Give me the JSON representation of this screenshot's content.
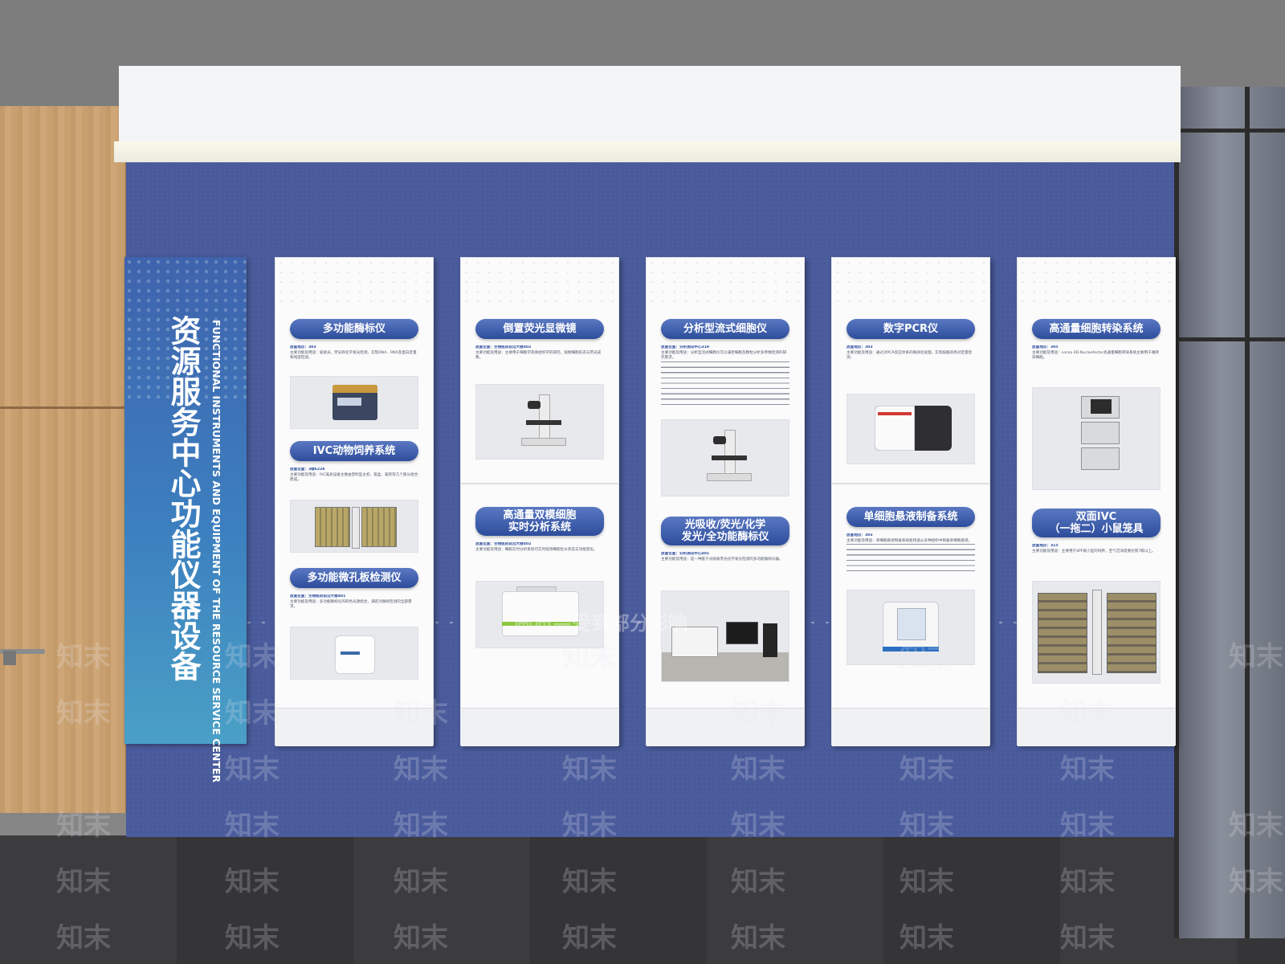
{
  "title_panel": {
    "title_cn": "资源服务中心功能仪器设备",
    "title_en": "FUNCTIONAL INSTRUMENTS AND EQUIPMENT OF THE RESOURCE SERVICE CENTER"
  },
  "panels": [
    {
      "items": [
        {
          "title": "多功能酶标仪",
          "location": "放置地点：303",
          "description": "主要功能及用途：吸收光、荧光和化学发光检测，实现DNA、RNA及蛋白定量和纯度检测。"
        },
        {
          "title": "IVC动物饲养系统",
          "location": "放置位置：3楼E228",
          "description": "主要功能及用途：IVC笼具设备主要由塑料型主机、笼盒、笼架等几个部分组合而成。"
        },
        {
          "title": "多功能微孔板检测仪",
          "location": "放置位置：生物医药前沿大楼401",
          "description": "主要功能及用途：多功能酶标仪的四色光源组合，满足对酶标检测的全部需求。"
        }
      ]
    },
    {
      "items": [
        {
          "title": "倒置荧光显微镜",
          "location": "放置位置：生物医药前沿大楼402",
          "description": "主要功能及用途：主要用于细胞学及微组织学的研究，观察细胞形态与荧光成像。"
        },
        {
          "title": "高通量双模细胞\n实时分析系统",
          "location": "放置位置：生物医药前沿大楼402",
          "description": "主要功能及用途：细胞实时分析系统可实时观测细胞生长状态与功能变化。"
        }
      ]
    },
    {
      "items": [
        {
          "title": "分析型流式细胞仪",
          "location": "放置位置：分析测试中心319",
          "description": "主要功能及用途：分析型流式细胞仪可以满足细胞及颗粒分析多参数检测的研究需求。"
        },
        {
          "title": "光吸收/荧光/化学\n发光/全功能酶标仪",
          "location": "放置位置：分析测试中心401",
          "description": "主要功能及用途：是一种基于光吸收荧光化学发光检测的多功能酶标仪器。"
        }
      ]
    },
    {
      "items": [
        {
          "title": "数字PCR仪",
          "location": "放置地点：303",
          "description": "主要功能及用途：通过对PCR反应体系的微滴化处理，实现核酸的绝对定量检测。"
        },
        {
          "title": "单细胞悬液制备系统",
          "location": "放置地点：303",
          "description": "主要功能及用途：单细胞悬液制备系统能快速从多种组织中制备单细胞悬液。"
        }
      ]
    },
    {
      "items": [
        {
          "title": "高通量细胞转染系统",
          "location": "放置地点：305",
          "description": "主要功能及用途：Lonza 4D-Nucleofector高通量细胞转染系统主要用于难转染细胞。"
        },
        {
          "title": "双面IVC\n（一拖二）小鼠笼具",
          "location": "放置地点：315",
          "description": "主要功能及用途：主要用于SPF级小型的饲养，空气洁净度要达到7级以上。"
        }
      ]
    }
  ],
  "watermark": "知末",
  "watermark_note": "画质会受到部分影响"
}
